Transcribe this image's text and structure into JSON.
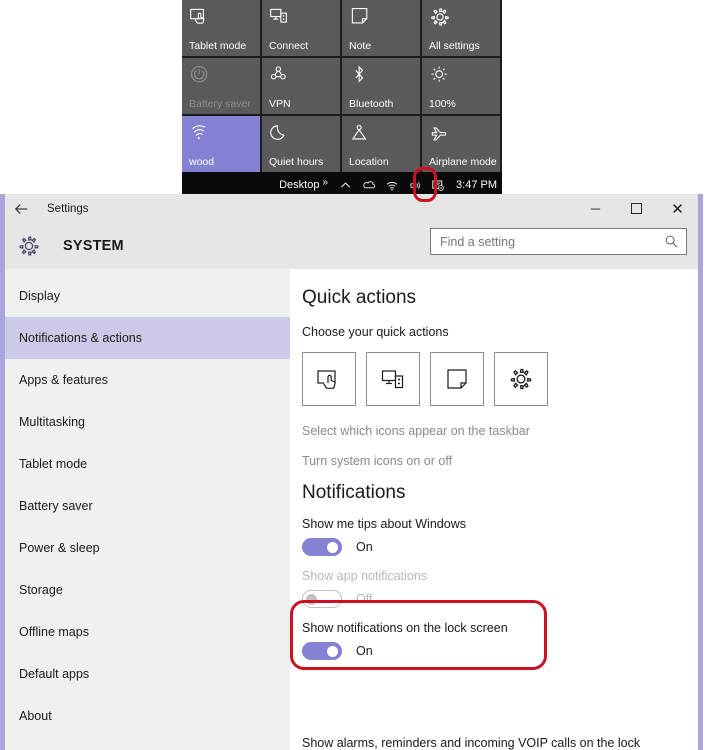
{
  "action_center": {
    "tiles": [
      {
        "label": "Tablet mode",
        "icon": "tablet-mode-icon",
        "state": "normal"
      },
      {
        "label": "Connect",
        "icon": "connect-icon",
        "state": "normal"
      },
      {
        "label": "Note",
        "icon": "note-icon",
        "state": "normal"
      },
      {
        "label": "All settings",
        "icon": "gear-icon",
        "state": "normal"
      },
      {
        "label": "Battery saver",
        "icon": "battery-saver-icon",
        "state": "disabled"
      },
      {
        "label": "VPN",
        "icon": "vpn-icon",
        "state": "normal"
      },
      {
        "label": "Bluetooth",
        "icon": "bluetooth-icon",
        "state": "normal"
      },
      {
        "label": "100%",
        "icon": "brightness-icon",
        "state": "normal"
      },
      {
        "label": "wood",
        "icon": "wifi-icon",
        "state": "active"
      },
      {
        "label": "Quiet hours",
        "icon": "moon-icon",
        "state": "normal"
      },
      {
        "label": "Location",
        "icon": "location-icon",
        "state": "normal"
      },
      {
        "label": "Airplane mode",
        "icon": "airplane-icon",
        "state": "normal"
      }
    ],
    "active_color": "#8581d4",
    "tile_color": "#5a5a5a"
  },
  "taskbar": {
    "desktop_label": "Desktop",
    "overflow_chevrons": "»",
    "up_arrow": "show-hidden-icons-icon",
    "icons": [
      "onedrive-icon",
      "network-icon",
      "volume-icon",
      "action-center-icon"
    ],
    "time": "3:47 PM",
    "highlight_color": "#cc1122"
  },
  "window": {
    "title": "Settings",
    "back_label": "←",
    "minimize_label": "─",
    "maximize_label": "☐",
    "close_label": "✕",
    "category": "SYSTEM",
    "border_color": "#a9a6dd"
  },
  "search": {
    "placeholder": "Find a setting",
    "value": ""
  },
  "sidebar": {
    "items": [
      {
        "label": "Display",
        "selected": false
      },
      {
        "label": "Notifications & actions",
        "selected": true
      },
      {
        "label": "Apps & features",
        "selected": false
      },
      {
        "label": "Multitasking",
        "selected": false
      },
      {
        "label": "Tablet mode",
        "selected": false
      },
      {
        "label": "Battery saver",
        "selected": false
      },
      {
        "label": "Power & sleep",
        "selected": false
      },
      {
        "label": "Storage",
        "selected": false
      },
      {
        "label": "Offline maps",
        "selected": false
      },
      {
        "label": "Default apps",
        "selected": false
      },
      {
        "label": "About",
        "selected": false
      }
    ],
    "selected_color": "#cbcbe9"
  },
  "content": {
    "quick_actions": {
      "heading": "Quick actions",
      "subheading": "Choose your quick actions",
      "tiles": [
        {
          "icon": "tablet-mode-icon"
        },
        {
          "icon": "connect-icon"
        },
        {
          "icon": "note-icon"
        },
        {
          "icon": "gear-icon"
        }
      ],
      "link_taskbar_icons": "Select which icons appear on the taskbar",
      "link_system_icons": "Turn system icons on or off"
    },
    "notifications": {
      "heading": "Notifications",
      "settings": [
        {
          "label": "Show me tips about Windows",
          "state": "On",
          "on": true,
          "disabled": false
        },
        {
          "label": "Show app notifications",
          "state": "Off",
          "on": false,
          "disabled": true
        },
        {
          "label": "Show notifications on the lock screen",
          "state": "On",
          "on": true,
          "disabled": false
        }
      ],
      "cut_off_label": "Show alarms, reminders and incoming VOIP calls on the lock",
      "highlight_color": "#cc1122"
    }
  }
}
